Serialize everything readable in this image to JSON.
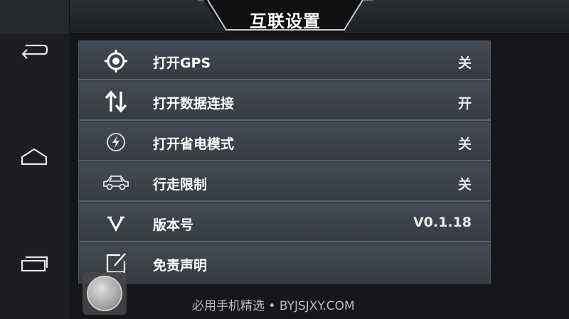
{
  "header": {
    "title": "互联设置"
  },
  "nav": {
    "back_icon": "back-arrow-icon",
    "home_icon": "home-icon",
    "recent_icon": "recent-apps-icon"
  },
  "settings": {
    "items": [
      {
        "icon": "gps-target-icon",
        "label": "打开GPS",
        "value": "关"
      },
      {
        "icon": "data-arrows-icon",
        "label": "打开数据连接",
        "value": "开"
      },
      {
        "icon": "power-save-bolt-icon",
        "label": "打开省电模式",
        "value": "关"
      },
      {
        "icon": "car-icon",
        "label": "行走限制",
        "value": "关"
      },
      {
        "icon": "version-v-icon",
        "label": "版本号",
        "value": "V0.1.18"
      },
      {
        "icon": "edit-note-icon",
        "label": "免责声明",
        "value": ""
      }
    ]
  },
  "watermark": {
    "text": "必用手机精选 • BYJSJXY.COM"
  },
  "colors": {
    "background": "#141619",
    "panel": "#3a3f47",
    "row_divider": "#5e636b"
  }
}
